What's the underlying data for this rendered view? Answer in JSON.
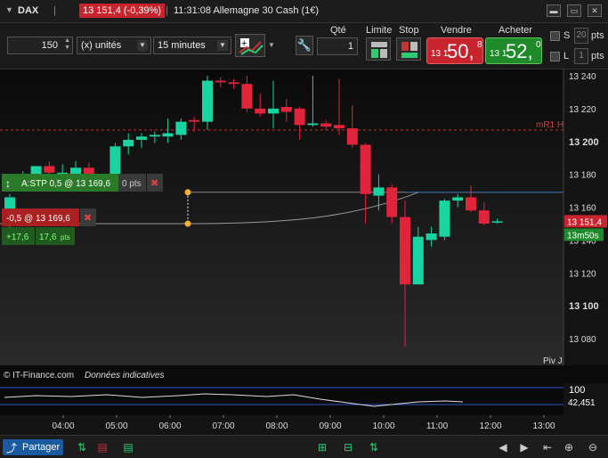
{
  "titlebar": {
    "arrow": "▼",
    "symbol": "DAX",
    "price_badge": "13 151,4 (-0,39%)",
    "time_label": "11:31:08 Allemagne 30 Cash (1€)"
  },
  "toolbar": {
    "units_value": "150",
    "units_type": "(x) unités",
    "timeframe": "15 minutes",
    "qty_label": "Qté",
    "qty_value": "1",
    "limit_label": "Limite",
    "stop_label": "Stop",
    "sell_label": "Vendre",
    "sell_prefix": "13 1",
    "sell_big": "50,",
    "sell_sup": "8",
    "buy_label": "Acheter",
    "buy_prefix": "13 1",
    "buy_big": "52,",
    "buy_sup": "0",
    "s_label": "S",
    "s_value": "20",
    "pts_label": "pts",
    "l_label": "L",
    "l_value": "1",
    "pts2_label": "pts"
  },
  "chart": {
    "stop_order_label": "A:STP  0,5 @ 13 169,6",
    "stop_pts": "0 pts",
    "position_label": "-0,5 @ 13 169,6",
    "pnl_value": "+17,6",
    "pnl_pts_value": "17,6",
    "pnl_pts_unit": "pts",
    "pivot_label": "mR1 H",
    "pivot_bottom_label": "Piv J",
    "price_tag": "13 151,4",
    "countdown_tag": "13m50s",
    "copyright": "© IT-Finance.com",
    "disclaimer": "Données indicatives",
    "indicator_top": "100",
    "indicator_value": "42,451"
  },
  "chart_data": {
    "type": "candlestick",
    "y_ticks": [
      "13 240",
      "13 220",
      "13 200",
      "13 180",
      "13 160",
      "13 140",
      "13 120",
      "13 100",
      "13 080"
    ],
    "ylim": [
      13068,
      13250
    ],
    "x_ticks": [
      "04:00",
      "05:00",
      "06:00",
      "07:00",
      "08:00",
      "09:00",
      "10:00",
      "11:00",
      "12:00",
      "13:00"
    ],
    "pivot_mR1H": 13207,
    "stop_level": 13169.6,
    "candles": [
      {
        "o": 13150,
        "h": 13168,
        "l": 13145,
        "c": 13166
      },
      {
        "o": 13176,
        "h": 13182,
        "l": 13170,
        "c": 13179
      },
      {
        "o": 13178,
        "h": 13183,
        "l": 13172,
        "c": 13185
      },
      {
        "o": 13185,
        "h": 13188,
        "l": 13178,
        "c": 13181
      },
      {
        "o": 13179,
        "h": 13186,
        "l": 13176,
        "c": 13181
      },
      {
        "o": 13180,
        "h": 13188,
        "l": 13176,
        "c": 13184
      },
      {
        "o": 13184,
        "h": 13187,
        "l": 13174,
        "c": 13176
      },
      {
        "o": 13176,
        "h": 13180,
        "l": 13170,
        "c": 13175
      },
      {
        "o": 13175,
        "h": 13199,
        "l": 13173,
        "c": 13197
      },
      {
        "o": 13197,
        "h": 13205,
        "l": 13192,
        "c": 13201
      },
      {
        "o": 13201,
        "h": 13205,
        "l": 13196,
        "c": 13203
      },
      {
        "o": 13203,
        "h": 13206,
        "l": 13199,
        "c": 13204
      },
      {
        "o": 13203,
        "h": 13214,
        "l": 13199,
        "c": 13205
      },
      {
        "o": 13204,
        "h": 13214,
        "l": 13201,
        "c": 13212
      },
      {
        "o": 13213,
        "h": 13215,
        "l": 13206,
        "c": 13212
      },
      {
        "o": 13212,
        "h": 13240,
        "l": 13207,
        "c": 13237
      },
      {
        "o": 13237,
        "h": 13239,
        "l": 13233,
        "c": 13236
      },
      {
        "o": 13236,
        "h": 13238,
        "l": 13232,
        "c": 13235
      },
      {
        "o": 13235,
        "h": 13240,
        "l": 13218,
        "c": 13220
      },
      {
        "o": 13220,
        "h": 13229,
        "l": 13215,
        "c": 13217
      },
      {
        "o": 13217,
        "h": 13237,
        "l": 13208,
        "c": 13220
      },
      {
        "o": 13221,
        "h": 13226,
        "l": 13212,
        "c": 13218
      },
      {
        "o": 13220,
        "h": 13221,
        "l": 13201,
        "c": 13210
      },
      {
        "o": 13210,
        "h": 13240,
        "l": 13209,
        "c": 13211
      },
      {
        "o": 13211,
        "h": 13213,
        "l": 13207,
        "c": 13209
      },
      {
        "o": 13210,
        "h": 13238,
        "l": 13204,
        "c": 13208
      },
      {
        "o": 13208,
        "h": 13222,
        "l": 13196,
        "c": 13198
      },
      {
        "o": 13198,
        "h": 13199,
        "l": 13150,
        "c": 13168
      },
      {
        "o": 13167,
        "h": 13180,
        "l": 13158,
        "c": 13172
      },
      {
        "o": 13172,
        "h": 13174,
        "l": 13150,
        "c": 13154
      },
      {
        "o": 13154,
        "h": 13164,
        "l": 13075,
        "c": 13113
      },
      {
        "o": 13113,
        "h": 13148,
        "l": 13113,
        "c": 13142
      },
      {
        "o": 13140,
        "h": 13148,
        "l": 13136,
        "c": 13144
      },
      {
        "o": 13142,
        "h": 13165,
        "l": 13140,
        "c": 13164
      },
      {
        "o": 13164,
        "h": 13168,
        "l": 13160,
        "c": 13166
      },
      {
        "o": 13166,
        "h": 13173,
        "l": 13157,
        "c": 13158
      },
      {
        "o": 13158,
        "h": 13163,
        "l": 13149,
        "c": 13150
      },
      {
        "o": 13151,
        "h": 13153,
        "l": 13150,
        "c": 13151.4
      }
    ]
  },
  "footer": {
    "share_label": "Partager"
  }
}
